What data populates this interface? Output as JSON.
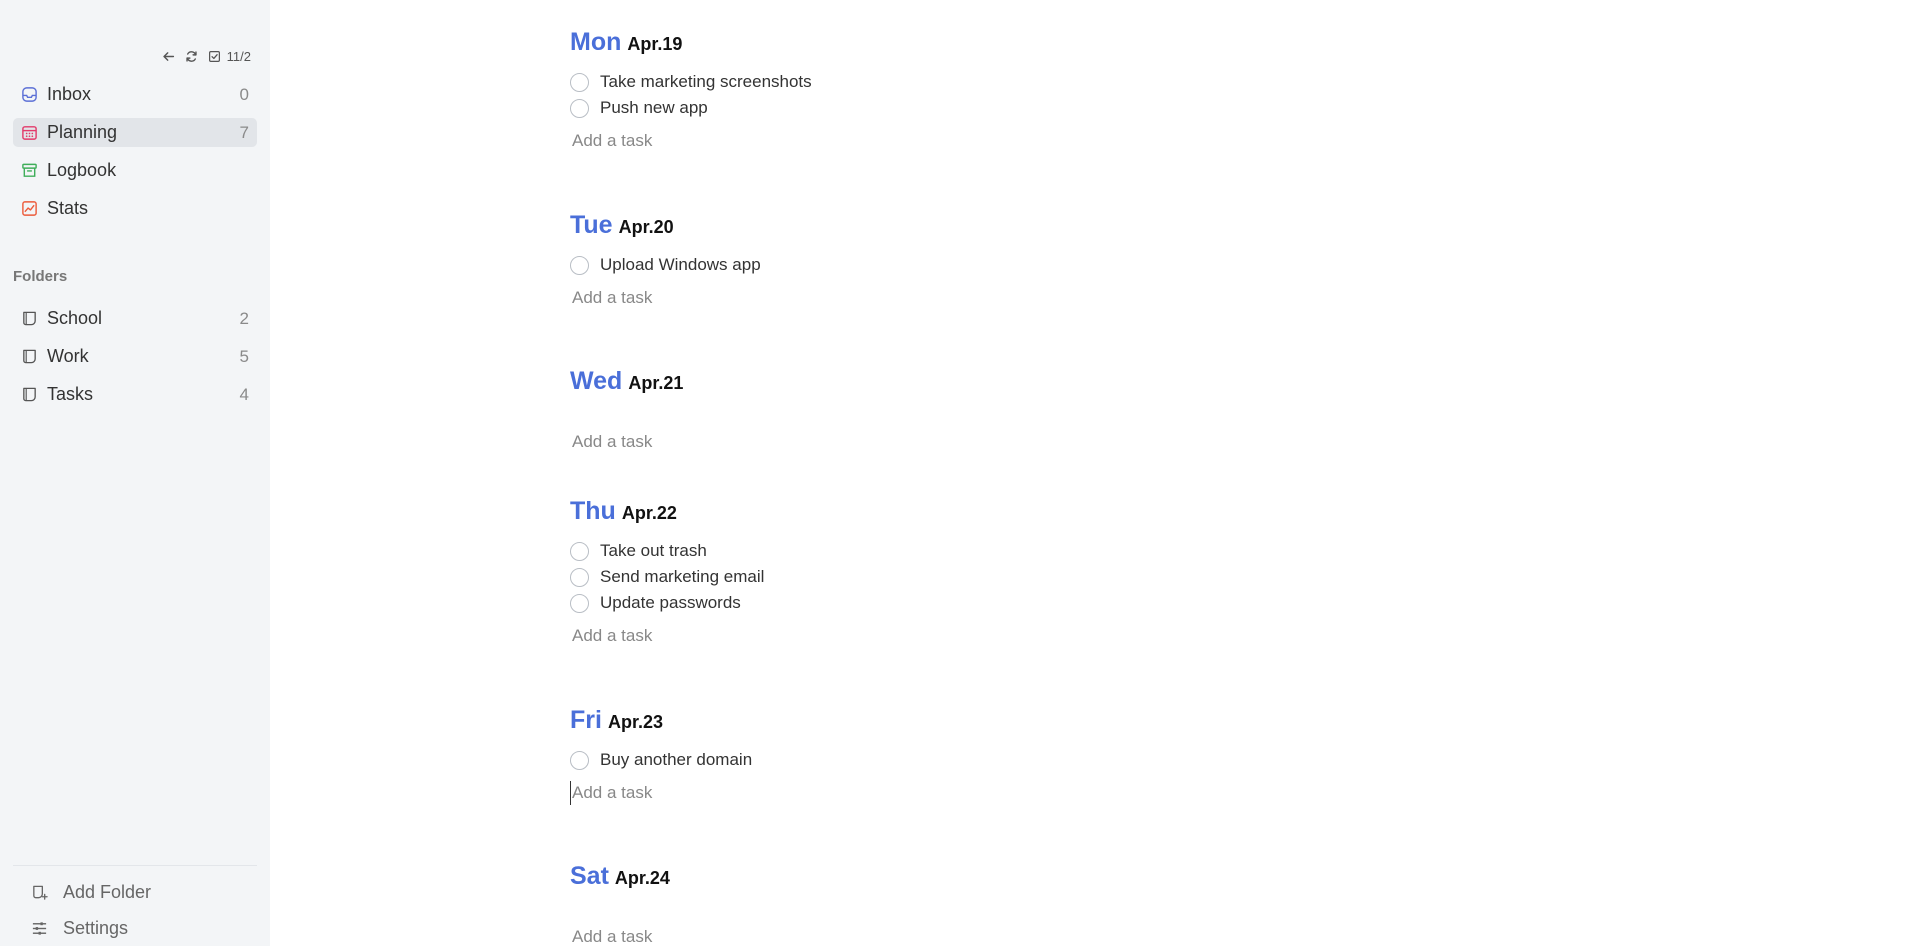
{
  "toolbar": {
    "count": "11/2"
  },
  "nav": [
    {
      "label": "Inbox",
      "count": "0",
      "icon": "inbox-icon",
      "color": "#5b6fd6"
    },
    {
      "label": "Planning",
      "count": "7",
      "icon": "calendar-icon",
      "color": "#e23a6a",
      "active": true
    },
    {
      "label": "Logbook",
      "count": "",
      "icon": "archive-icon",
      "color": "#3fae5a"
    },
    {
      "label": "Stats",
      "count": "",
      "icon": "chart-icon",
      "color": "#ec5b3b"
    }
  ],
  "folders_heading": "Folders",
  "folders": [
    {
      "label": "School",
      "count": "2",
      "icon": "folder-icon"
    },
    {
      "label": "Work",
      "count": "5",
      "icon": "folder-icon"
    },
    {
      "label": "Tasks",
      "count": "4",
      "icon": "folder-icon"
    }
  ],
  "footer": {
    "add_folder": "Add Folder",
    "settings": "Settings"
  },
  "add_task_placeholder": "Add a task",
  "days": [
    {
      "name": "Mon",
      "date": "Apr.19",
      "tasks": [
        "Take marketing screenshots",
        "Push new app"
      ]
    },
    {
      "name": "Tue",
      "date": "Apr.20",
      "tasks": [
        "Upload Windows app"
      ]
    },
    {
      "name": "Wed",
      "date": "Apr.21",
      "tasks": []
    },
    {
      "name": "Thu",
      "date": "Apr.22",
      "tasks": [
        "Take out trash",
        "Send marketing email",
        "Update passwords"
      ]
    },
    {
      "name": "Fri",
      "date": "Apr.23",
      "tasks": [
        "Buy another domain"
      ]
    },
    {
      "name": "Sat",
      "date": "Apr.24",
      "tasks": []
    }
  ],
  "colors": {
    "accent": "#4a6fd9",
    "sidebar_bg": "#f3f5f7",
    "active_bg": "#e2e5e9"
  }
}
